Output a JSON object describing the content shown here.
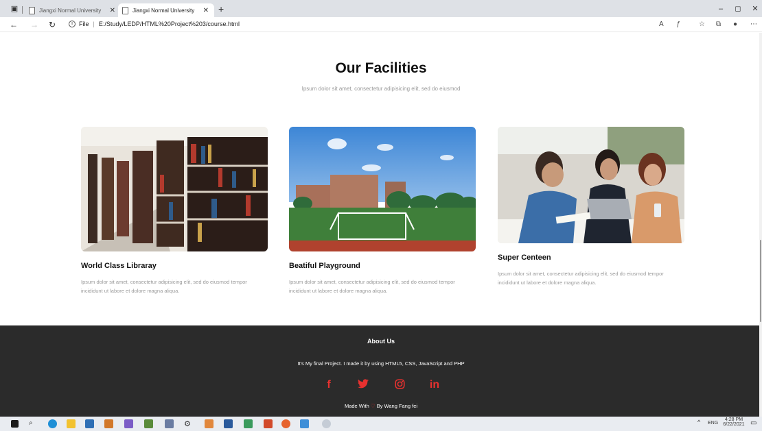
{
  "browser": {
    "tabs": [
      {
        "label": "Jiangxi Normal University",
        "active": false
      },
      {
        "label": "Jiangxi Normal University",
        "active": true
      }
    ],
    "address": {
      "protocol": "File",
      "url": "E:/Study/LEDP/HTML%20Project%203/course.html"
    }
  },
  "page": {
    "heading": "Our Facilities",
    "subheading": "Ipsum dolor sit amet, consectetur adipisicing elit, sed do eiusmod",
    "cards": [
      {
        "title": "World Class Libraray",
        "text": "Ipsum dolor sit amet, consectetur adipisicing elit, sed do eiusmod tempor incididunt ut labore et dolore magna aliqua."
      },
      {
        "title": "Beatiful Playground",
        "text": "Ipsum dolor sit amet, consectetur adipisicing elit, sed do eiusmod tempor incididunt ut labore et dolore magna aliqua."
      },
      {
        "title": "Super Centeen",
        "text": "Ipsum dolor sit amet, consectetur adipisicing elit, sed do eiusmod tempor incididunt ut labore et dolore magna aliqua."
      }
    ]
  },
  "footer": {
    "title": "About Us",
    "text": "It's My final Project. I made it by using HTML5, CSS, JavaScript and PHP",
    "social": {
      "facebook": "f",
      "linkedin": "in"
    },
    "made_prefix": "Made With",
    "made_suffix": "By Wang Fang fei",
    "accent_color": "#e8312f"
  },
  "taskbar": {
    "lang": "ENG",
    "time": "4:28 PM",
    "date": "6/22/2021"
  }
}
